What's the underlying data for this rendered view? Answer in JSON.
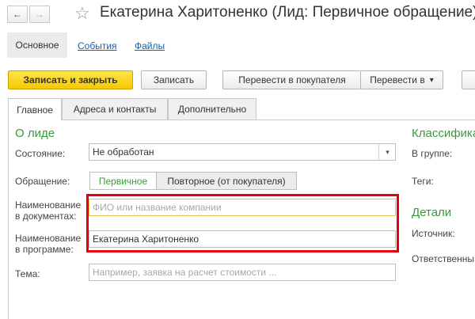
{
  "window": {
    "title": "Екатерина Харитоненко (Лид: Первичное обращение)"
  },
  "nav": {
    "back_icon": "←",
    "forward_icon": "→",
    "star_icon": "☆"
  },
  "top_tabs": {
    "main": "Основное",
    "events": "События",
    "files": "Файлы"
  },
  "toolbar": {
    "save_close": "Записать и закрыть",
    "save": "Записать",
    "convert_buyer": "Перевести в покупателя",
    "convert_to": "Перевести в",
    "dropdown_icon": "▾"
  },
  "tabs": {
    "main": "Главное",
    "addresses": "Адреса и контакты",
    "extra": "Дополнительно"
  },
  "about": {
    "section_title": "О лиде",
    "state_label": "Состояние:",
    "state_value": "Не обработан",
    "appeal_label": "Обращение:",
    "appeal_primary": "Первичное",
    "appeal_repeat": "Повторное (от покупателя)",
    "doc_name_label_1": "Наименование",
    "doc_name_label_2": "в документах:",
    "doc_name_placeholder": "ФИО или название компании",
    "prog_name_label_1": "Наименование",
    "prog_name_label_2": "в программе:",
    "prog_name_value": "Екатерина Харитоненко",
    "topic_label": "Тема:",
    "topic_placeholder": "Например, заявка на расчет стоимости ..."
  },
  "classification": {
    "section_title": "Классифика",
    "group_label": "В группе:",
    "tags_label": "Теги:"
  },
  "details": {
    "section_title": "Детали",
    "source_label": "Источник:",
    "responsible_label": "Ответственны"
  },
  "colors": {
    "accent_green": "#3a9a3a",
    "link_blue": "#1d5fa5",
    "primary_yellow": "#f6c800",
    "highlight_red": "#e3000f"
  }
}
